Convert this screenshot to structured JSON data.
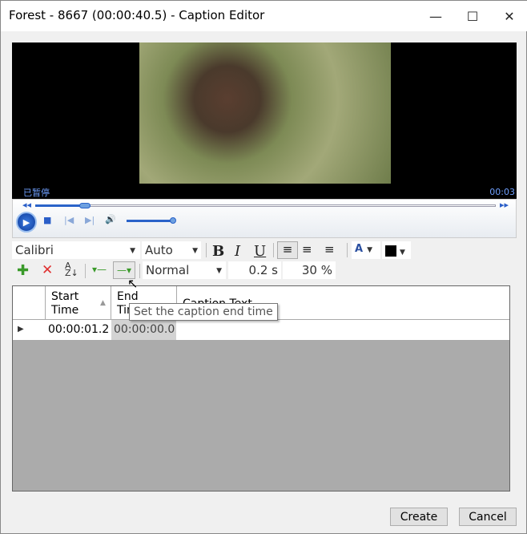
{
  "window": {
    "title": "Forest - 8667 (00:00:40.5) - Caption Editor"
  },
  "player": {
    "status": "已暂停",
    "time": "00:03",
    "seek_progress": 0.12,
    "volume": 0.5
  },
  "format": {
    "font": "Calibri",
    "size": "Auto",
    "bold": "B",
    "italic": "I",
    "underline": "U",
    "font_color_letter": "A",
    "style": "Normal",
    "duration": "0.2 s",
    "opacity": "30 %"
  },
  "grid": {
    "columns": [
      "Start Time",
      "End Time",
      "Caption Text"
    ],
    "rows": [
      {
        "start": "00:00:01.2",
        "end": "00:00:00.0",
        "text": ""
      }
    ]
  },
  "tooltip": "Set the caption end time",
  "buttons": {
    "create": "Create",
    "cancel": "Cancel"
  }
}
